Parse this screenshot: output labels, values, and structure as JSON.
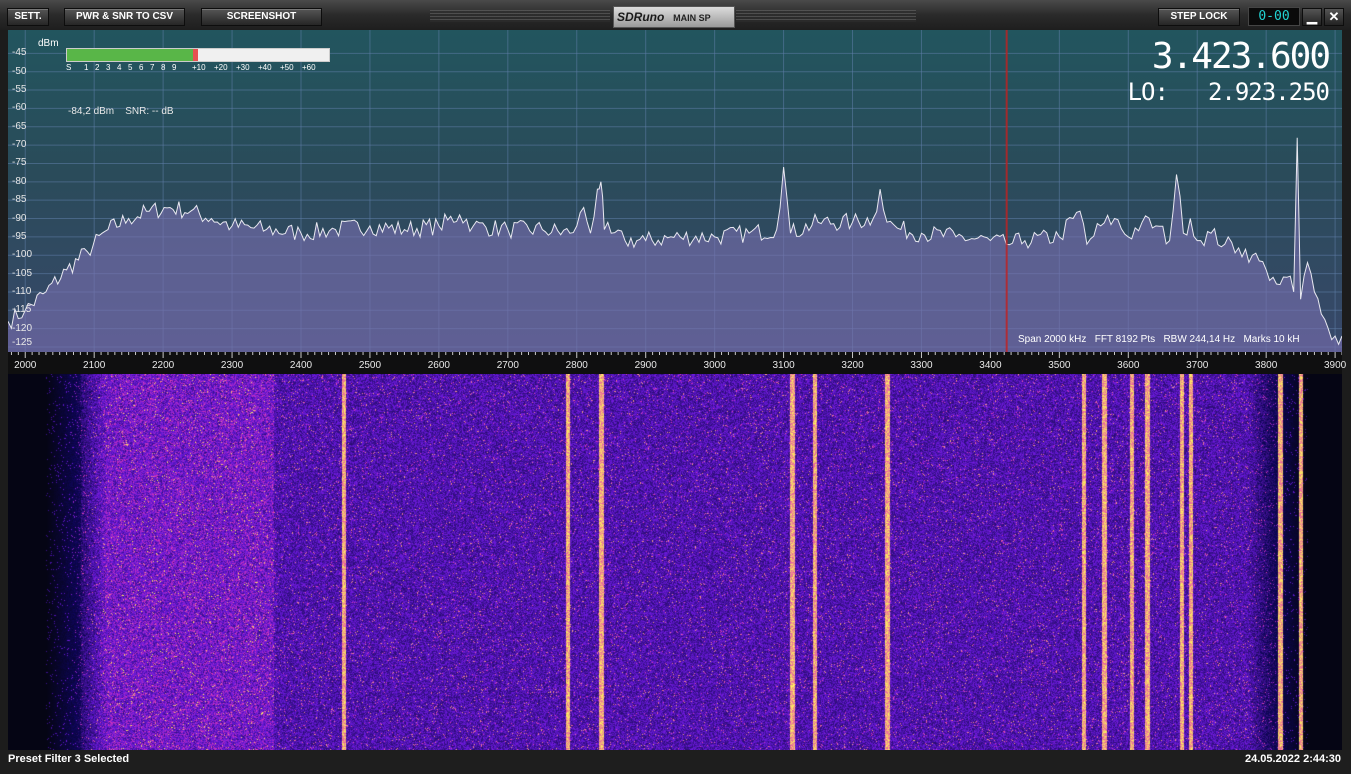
{
  "toolbar": {
    "sett": "SETT.",
    "pwr_snr": "PWR & SNR TO CSV",
    "screenshot": "SCREENSHOT",
    "brand_logo": "SDRuno",
    "brand_label": "MAIN SP",
    "step_lock": "STEP LOCK",
    "clock_display": "0-00",
    "minimize": "▁",
    "close": "✕"
  },
  "smeter": {
    "unit": "dBm",
    "level_fraction": 0.5,
    "scale": [
      "S",
      "1",
      "2",
      "3",
      "4",
      "5",
      "6",
      "7",
      "8",
      "9",
      "+10",
      "+20",
      "+30",
      "+40",
      "+50",
      "+60"
    ]
  },
  "readout": {
    "power": "-84,2 dBm",
    "snr": "SNR: -- dB"
  },
  "frequency": {
    "main": "3.423.600",
    "lo_label": "LO:",
    "lo_value": "2.923.250"
  },
  "span_info": "Span 2000 kHz   FFT 8192 Pts   RBW 244,14 Hz   Marks 10 kH",
  "colors": {
    "trace": "#e8e8f0",
    "fill": "#7a6fb0",
    "marker": "#c02020",
    "waterfall_bg": "#050512"
  },
  "chart_data": {
    "type": "line",
    "title": "",
    "xlabel": "",
    "ylabel": "dBm",
    "xlim": [
      1975,
      3910
    ],
    "ylim": [
      -125,
      -40
    ],
    "x_ticks": [
      2000,
      2100,
      2200,
      2300,
      2400,
      2500,
      2600,
      2700,
      2800,
      2900,
      3000,
      3100,
      3200,
      3300,
      3400,
      3500,
      3600,
      3700,
      3800,
      3900
    ],
    "y_ticks": [
      -45,
      -50,
      -55,
      -60,
      -65,
      -70,
      -75,
      -80,
      -85,
      -90,
      -95,
      -100,
      -105,
      -110,
      -115,
      -120,
      -125
    ],
    "marker_freq": 3423.6,
    "series": [
      {
        "x": [
          1975,
          2000,
          2030,
          2060,
          2090,
          2120,
          2150,
          2180,
          2210,
          2240,
          2270,
          2300,
          2350,
          2400,
          2450,
          2500,
          2550,
          2600,
          2630,
          2650,
          2700,
          2750,
          2790,
          2800,
          2810,
          2820,
          2830,
          2835,
          2840,
          2850,
          2870,
          2900,
          2950,
          3000,
          3050,
          3090,
          3100,
          3110,
          3150,
          3200,
          3230,
          3240,
          3250,
          3270,
          3300,
          3350,
          3400,
          3423,
          3450,
          3500,
          3520,
          3530,
          3540,
          3560,
          3580,
          3600,
          3620,
          3640,
          3660,
          3670,
          3680,
          3690,
          3700,
          3720,
          3740,
          3760,
          3780,
          3800,
          3810,
          3820,
          3830,
          3840,
          3845,
          3850,
          3860,
          3870,
          3880,
          3890,
          3900,
          3910
        ],
        "y": [
          -118,
          -115,
          -110,
          -104,
          -99,
          -93,
          -90,
          -88,
          -87,
          -88,
          -90,
          -92,
          -93,
          -94,
          -93,
          -92,
          -93,
          -92,
          -89,
          -92,
          -93,
          -93,
          -94,
          -92,
          -87,
          -94,
          -82,
          -80,
          -93,
          -94,
          -96,
          -96,
          -95,
          -95,
          -94,
          -93,
          -76,
          -94,
          -91,
          -91,
          -90,
          -82,
          -91,
          -93,
          -94,
          -95,
          -96,
          -97,
          -96,
          -95,
          -90,
          -88,
          -97,
          -92,
          -90,
          -95,
          -91,
          -92,
          -96,
          -78,
          -94,
          -90,
          -96,
          -94,
          -97,
          -98,
          -100,
          -104,
          -106,
          -108,
          -106,
          -110,
          -68,
          -112,
          -102,
          -110,
          -116,
          -120,
          -122,
          -122
        ]
      }
    ]
  },
  "waterfall": {
    "strong_lines_khz": [
      2835,
      3112,
      3250,
      2462,
      3535,
      3565,
      3677,
      3690,
      3850,
      3820,
      3627,
      3605,
      2787,
      3145
    ],
    "noise_start_khz": 2030,
    "noise_end_khz": 3860
  },
  "status": {
    "left": "Preset Filter 3 Selected",
    "right": "24.05.2022 2:44:30"
  }
}
